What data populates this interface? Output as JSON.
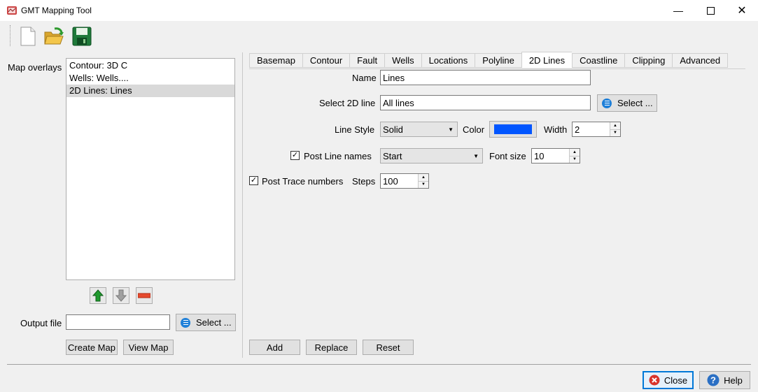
{
  "window": {
    "title": "GMT Mapping Tool"
  },
  "toolbar": {
    "icons": [
      "new-file-icon",
      "open-folder-icon",
      "save-disk-icon"
    ]
  },
  "left": {
    "map_overlays_label": "Map overlays",
    "overlays": [
      "Contour: 3D C",
      "Wells: Wells....",
      "2D Lines: Lines"
    ],
    "selected_index": 2,
    "output_file_label": "Output file",
    "output_file_value": "",
    "select_label": "Select ...",
    "create_map_label": "Create Map",
    "view_map_label": "View Map"
  },
  "tabs": [
    "Basemap",
    "Contour",
    "Fault",
    "Wells",
    "Locations",
    "Polyline",
    "2D Lines",
    "Coastline",
    "Clipping",
    "Advanced"
  ],
  "active_tab": "2D Lines",
  "form": {
    "name_label": "Name",
    "name_value": "Lines",
    "select_2d_label": "Select 2D line",
    "select_2d_value": "All lines",
    "select_label": "Select ...",
    "line_style_label": "Line Style",
    "line_style_value": "Solid",
    "color_label": "Color",
    "color_value": "#0055ff",
    "width_label": "Width",
    "width_value": "2",
    "post_line_names_label": "Post Line names",
    "post_line_names_checked": true,
    "post_line_names_value": "Start",
    "font_size_label": "Font size",
    "font_size_value": "10",
    "post_trace_label": "Post Trace numbers",
    "post_trace_checked": true,
    "steps_label": "Steps",
    "steps_value": "100"
  },
  "actions": {
    "add_label": "Add",
    "replace_label": "Replace",
    "reset_label": "Reset"
  },
  "footer": {
    "close_label": "Close",
    "help_label": "Help"
  },
  "colors": {
    "selected_row": "#d9d9d9",
    "accent_blue": "#1e7fd8",
    "close_red": "#d9342b"
  }
}
